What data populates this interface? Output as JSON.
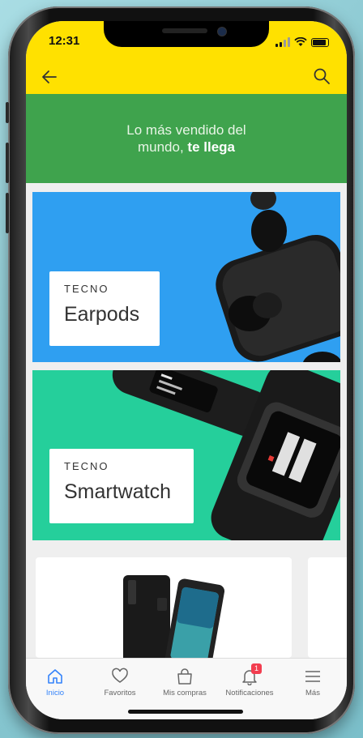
{
  "status_bar": {
    "time": "12:31"
  },
  "header": {
    "back_icon": "arrow-left-icon",
    "search_icon": "search-icon",
    "accent": "#ffe100"
  },
  "promo": {
    "line1": "Lo más vendido del",
    "line2_prefix": "mundo, ",
    "line2_bold": "te llega",
    "color": "#3fa34d"
  },
  "cards": [
    {
      "category": "TECNO",
      "name": "Earpods",
      "color": "#2f9ff1"
    },
    {
      "category": "TECNO",
      "name": "Smartwatch",
      "color": "#25cf9b"
    }
  ],
  "nav": {
    "items": [
      {
        "label": "Inicio",
        "icon": "home-icon",
        "active": true
      },
      {
        "label": "Favoritos",
        "icon": "heart-icon"
      },
      {
        "label": "Mis compras",
        "icon": "shopping-bag-icon"
      },
      {
        "label": "Notificaciones",
        "icon": "bell-icon",
        "badge": "1"
      },
      {
        "label": "Más",
        "icon": "menu-icon"
      }
    ],
    "active_color": "#3483fa"
  }
}
